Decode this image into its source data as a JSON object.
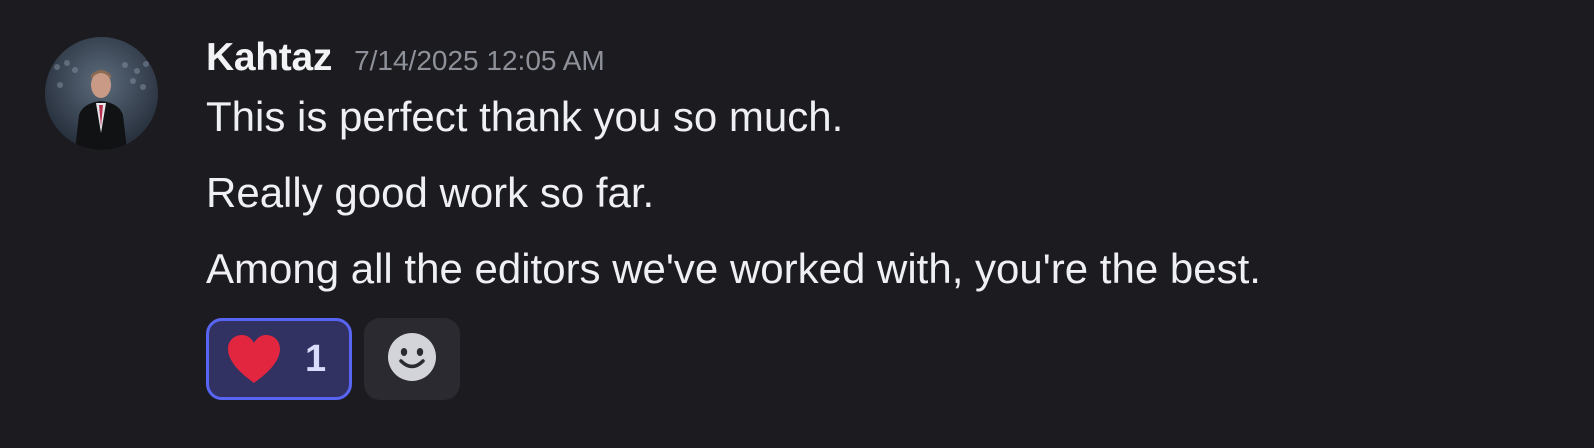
{
  "message": {
    "author": "Kahtaz",
    "timestamp": "7/14/2025 12:05 AM",
    "lines": [
      "This is perfect thank you so much.",
      "Really good work so far.",
      "Among all the editors we've worked with, you're the best."
    ]
  },
  "reactions": [
    {
      "emoji": "heart-icon",
      "count": "1",
      "reacted_by_me": true
    }
  ],
  "add_reaction_icon": "smiley-face-icon",
  "colors": {
    "background": "#1b1b20",
    "reaction_border": "#5865f2",
    "reaction_bg": "#313262",
    "heart": "#e3263f"
  }
}
